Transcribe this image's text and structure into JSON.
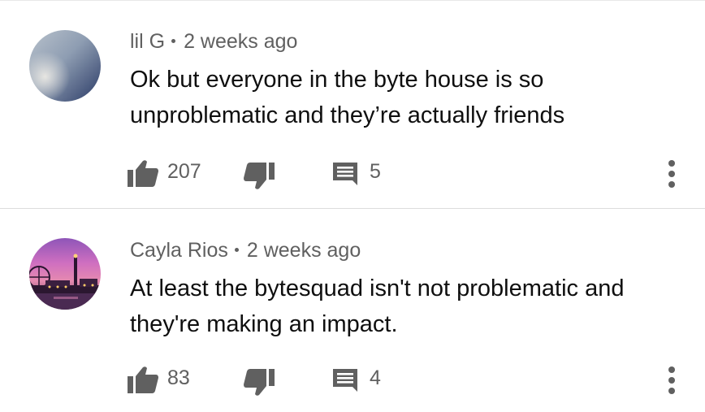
{
  "comments": [
    {
      "author": "lil G",
      "time": "2 weeks ago",
      "text": "Ok but everyone in the byte house is so unproblematic and they’re actually friends",
      "likes": "207",
      "replies": "5",
      "avatar_icon": "sky-avatar"
    },
    {
      "author": "Cayla Rios",
      "time": "2 weeks ago",
      "text": "At least the bytesquad isn't not problematic and they're making an impact.",
      "likes": "83",
      "replies": "4",
      "avatar_icon": "pier-sunset-avatar"
    }
  ],
  "icons": {
    "like": "thumbs-up-icon",
    "dislike": "thumbs-down-icon",
    "reply": "reply-comment-icon",
    "menu": "more-vertical-icon"
  },
  "colors": {
    "text_primary": "#0f0f0f",
    "text_secondary": "#606060",
    "icon": "#606060",
    "divider": "#dcdcdc"
  }
}
